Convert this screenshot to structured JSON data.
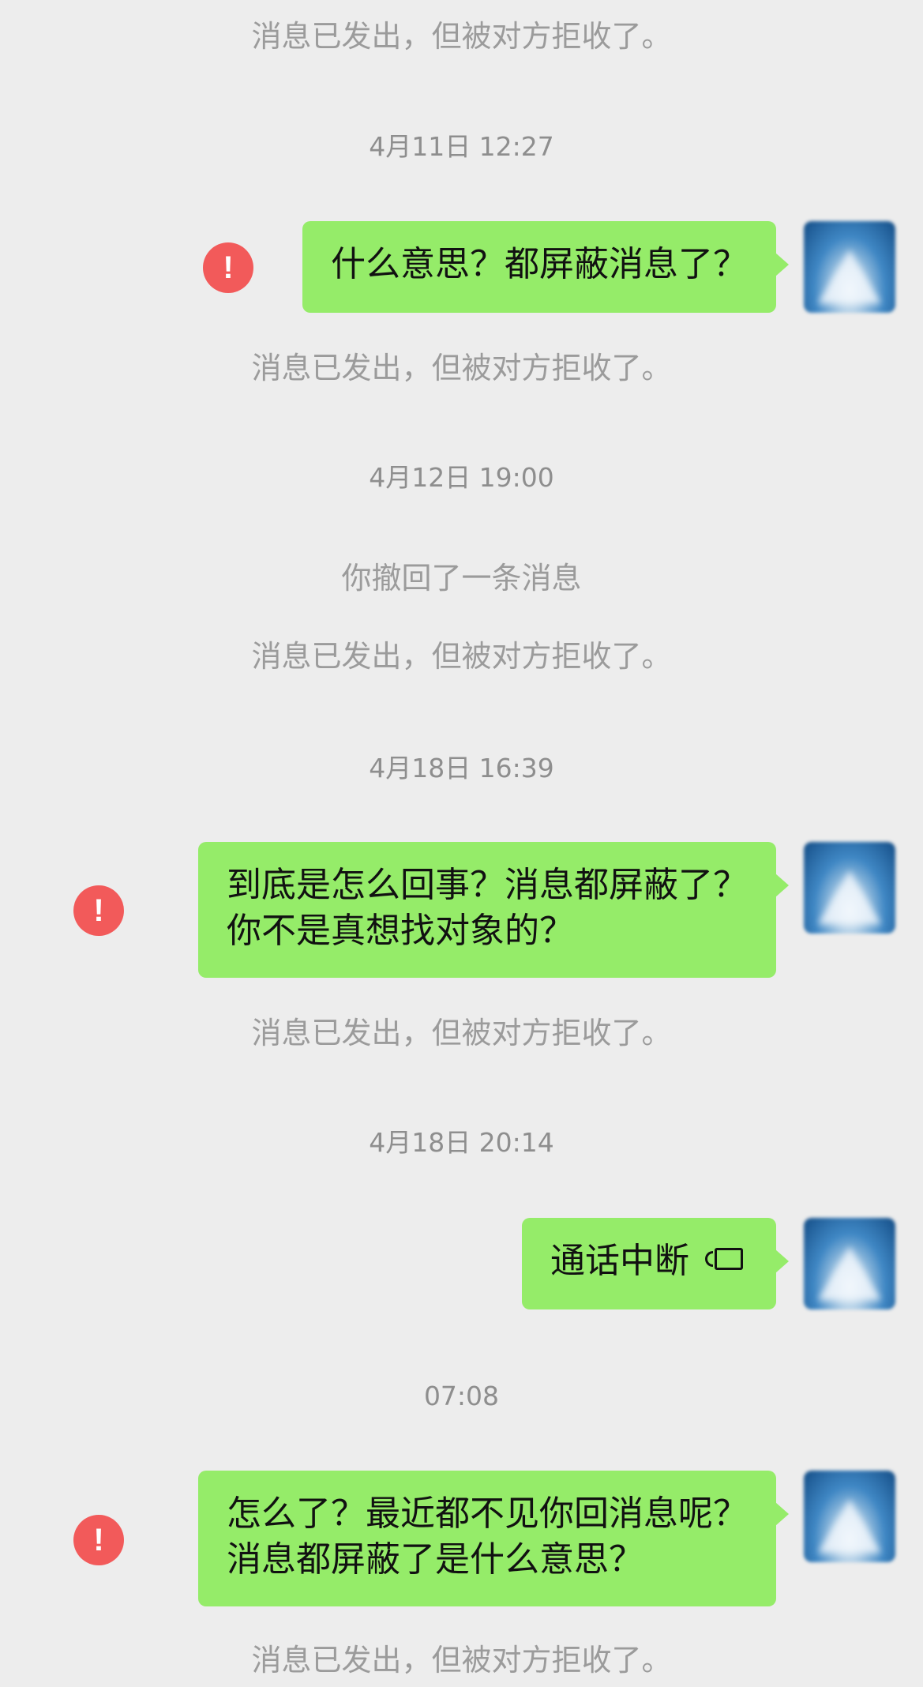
{
  "messages": [
    {
      "type": "system",
      "text": "消息已发出，但被对方拒收了。"
    },
    {
      "type": "timestamp",
      "text": "4月11日 12:27"
    },
    {
      "type": "sent",
      "lines": [
        "什么意思？都屏蔽消息了？"
      ],
      "failed": true
    },
    {
      "type": "system",
      "text": "消息已发出，但被对方拒收了。"
    },
    {
      "type": "timestamp",
      "text": "4月12日 19:00"
    },
    {
      "type": "system",
      "text": "你撤回了一条消息"
    },
    {
      "type": "system",
      "text": "消息已发出，但被对方拒收了。"
    },
    {
      "type": "timestamp",
      "text": "4月18日 16:39"
    },
    {
      "type": "sent",
      "lines": [
        "到底是怎么回事？消息都屏蔽了？",
        "你不是真想找对象的？"
      ],
      "failed": true
    },
    {
      "type": "system",
      "text": "消息已发出，但被对方拒收了。"
    },
    {
      "type": "timestamp",
      "text": "4月18日 20:14"
    },
    {
      "type": "call",
      "text": "通话中断",
      "icon": "video-call-icon"
    },
    {
      "type": "timestamp",
      "text": "07:08"
    },
    {
      "type": "sent",
      "lines": [
        "怎么了？最近都不见你回消息呢？",
        "消息都屏蔽了是什么意思？"
      ],
      "failed": true
    },
    {
      "type": "system",
      "text": "消息已发出，但被对方拒收了。"
    }
  ],
  "error_badge": "!",
  "colors": {
    "background": "#ededed",
    "bubble": "#95ec69",
    "error": "#f25a5a",
    "system_text": "#9b9b9b"
  }
}
